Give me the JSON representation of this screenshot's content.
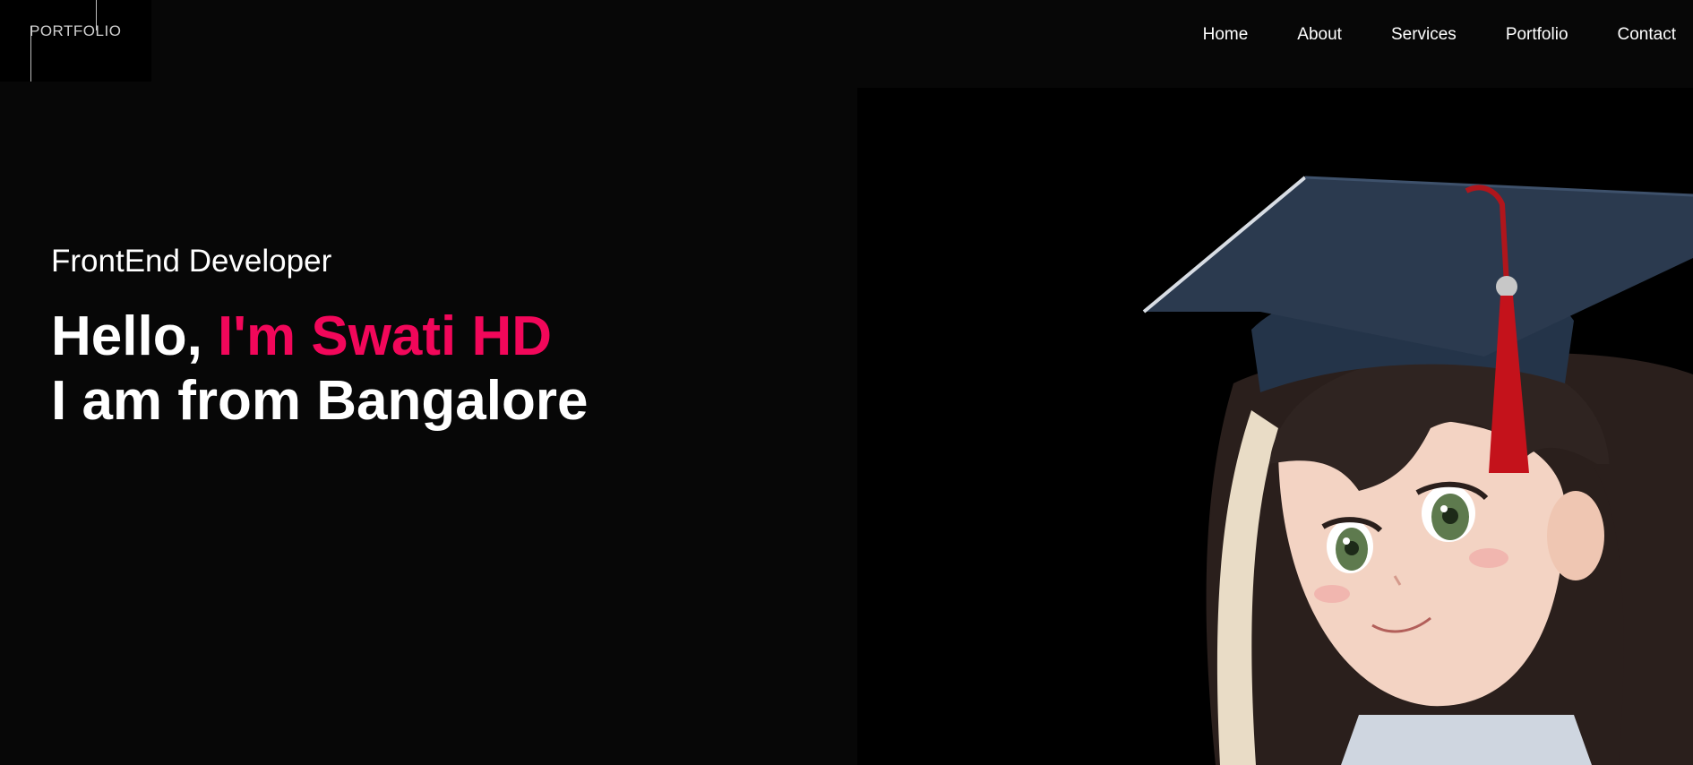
{
  "header": {
    "logo_text": "PORTFOLIO",
    "nav": [
      {
        "label": "Home"
      },
      {
        "label": "About"
      },
      {
        "label": "Services"
      },
      {
        "label": "Portfolio"
      },
      {
        "label": "Contact"
      }
    ]
  },
  "hero": {
    "subtitle": "FrontEnd Developer",
    "greeting": "Hello, ",
    "name": "I'm Swati HD",
    "location": "I am from Bangalore",
    "accent_color": "#f2075a"
  },
  "portrait": {
    "icon": "graduate-portrait-illustration"
  }
}
